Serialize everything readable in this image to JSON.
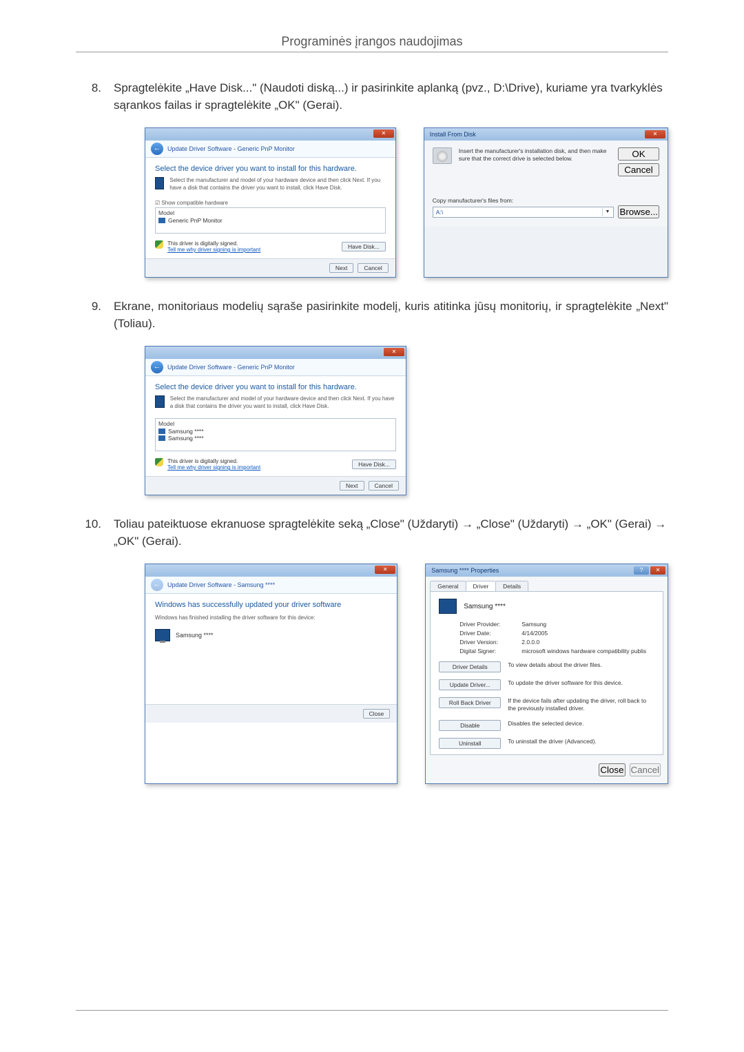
{
  "header": {
    "title": "Programinės įrangos naudojimas"
  },
  "steps": {
    "s8": {
      "num": "8.",
      "text": "Spragtelėkite „Have Disk...\" (Naudoti diską...) ir pasirinkite aplanką (pvz., D:\\Drive), kuriame yra tvarkyklės sąrankos failas ir spragtelėkite „OK\" (Gerai)."
    },
    "s9": {
      "num": "9.",
      "text": "Ekrane, monitoriaus modelių sąraše pasirinkite modelį, kuris atitinka jūsų monitorių, ir spragtelėkite „Next\" (Toliau)."
    },
    "s10": {
      "num": "10.",
      "text": "Toliau pateiktuose ekranuose spragtelėkite seką „Close\" (Uždaryti) → „Close\" (Uždaryti) → „OK\" (Gerai) → „OK\" (Gerai)."
    }
  },
  "wiz8": {
    "crumb": "Update Driver Software - Generic PnP Monitor",
    "heading": "Select the device driver you want to install for this hardware.",
    "desc": "Select the manufacturer and model of your hardware device and then click Next. If you have a disk that contains the driver you want to install, click Have Disk.",
    "show_compatible": "Show compatible hardware",
    "list_header": "Model",
    "list_item": "Generic PnP Monitor",
    "signed": "This driver is digitally signed.",
    "signed_link": "Tell me why driver signing is important",
    "have_disk": "Have Disk...",
    "next": "Next",
    "cancel": "Cancel"
  },
  "ifd": {
    "title": "Install From Disk",
    "instr": "Insert the manufacturer's installation disk, and then make sure that the correct drive is selected below.",
    "ok": "OK",
    "cancel": "Cancel",
    "copy_label": "Copy manufacturer's files from:",
    "combo_value": "A:\\",
    "browse": "Browse..."
  },
  "wiz9": {
    "crumb": "Update Driver Software - Generic PnP Monitor",
    "heading": "Select the device driver you want to install for this hardware.",
    "desc": "Select the manufacturer and model of your hardware device and then click Next. If you have a disk that contains the driver you want to install, click Have Disk.",
    "list_header": "Model",
    "list_item1": "Samsung ****",
    "list_item2": "Samsung ****",
    "signed": "This driver is digitally signed.",
    "signed_link": "Tell me why driver signing is important",
    "have_disk": "Have Disk...",
    "next": "Next",
    "cancel": "Cancel"
  },
  "wiz10l": {
    "crumb": "Update Driver Software - Samsung ****",
    "heading": "Windows has successfully updated your driver software",
    "sub": "Windows has finished installing the driver software for this device:",
    "device": "Samsung ****",
    "close": "Close"
  },
  "props": {
    "title": "Samsung **** Properties",
    "tab_general": "General",
    "tab_driver": "Driver",
    "tab_details": "Details",
    "device": "Samsung ****",
    "k_provider": "Driver Provider:",
    "v_provider": "Samsung",
    "k_date": "Driver Date:",
    "v_date": "4/14/2005",
    "k_version": "Driver Version:",
    "v_version": "2.0.0.0",
    "k_signer": "Digital Signer:",
    "v_signer": "microsoft windows hardware compatibility publis",
    "btn_details": "Driver Details",
    "txt_details": "To view details about the driver files.",
    "btn_update": "Update Driver...",
    "txt_update": "To update the driver software for this device.",
    "btn_rollback": "Roll Back Driver",
    "txt_rollback": "If the device fails after updating the driver, roll back to the previously installed driver.",
    "btn_disable": "Disable",
    "txt_disable": "Disables the selected device.",
    "btn_uninstall": "Uninstall",
    "txt_uninstall": "To uninstall the driver (Advanced).",
    "close": "Close",
    "cancel": "Cancel"
  }
}
